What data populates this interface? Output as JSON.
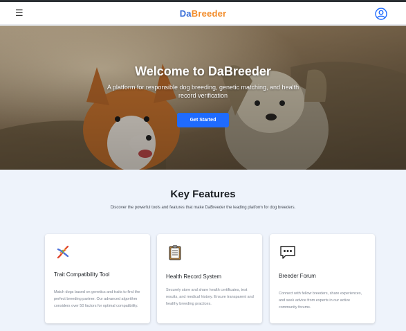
{
  "navbar": {
    "menu_icon": "hamburger-icon",
    "logo_part1": "Da",
    "logo_part2": "Breeder",
    "user_icon": "user-circle-icon"
  },
  "hero": {
    "title": "Welcome to DaBreeder",
    "subtitle": "A platform for responsible dog breeding, genetic matching, and health record verification",
    "cta_label": "Get Started"
  },
  "features": {
    "title": "Key Features",
    "subtitle": "Discover the powerful tools and features that make DaBreeder the leading platform for dog breeders.",
    "cards": [
      {
        "icon": "dna-icon",
        "title": "Trait Compatibility Tool",
        "description": "Match dogs based on genetics and traits to find the perfect breeding partner. Our advanced algorithm considers over 50 factors for optimal compatibility."
      },
      {
        "icon": "clipboard-icon",
        "title": "Health Record System",
        "description": "Securely store and share health certificates, test results, and medical history. Ensure transparent and healthy breeding practices."
      },
      {
        "icon": "speech-bubble-icon",
        "title": "Breeder Forum",
        "description": "Connect with fellow breeders, share experiences, and seek advice from experts in our active community forums."
      }
    ]
  },
  "colors": {
    "primary": "#1f6bff",
    "logo_blue": "#3a6fd8",
    "logo_orange": "#f28c2a",
    "page_bg": "#eef3fb"
  }
}
